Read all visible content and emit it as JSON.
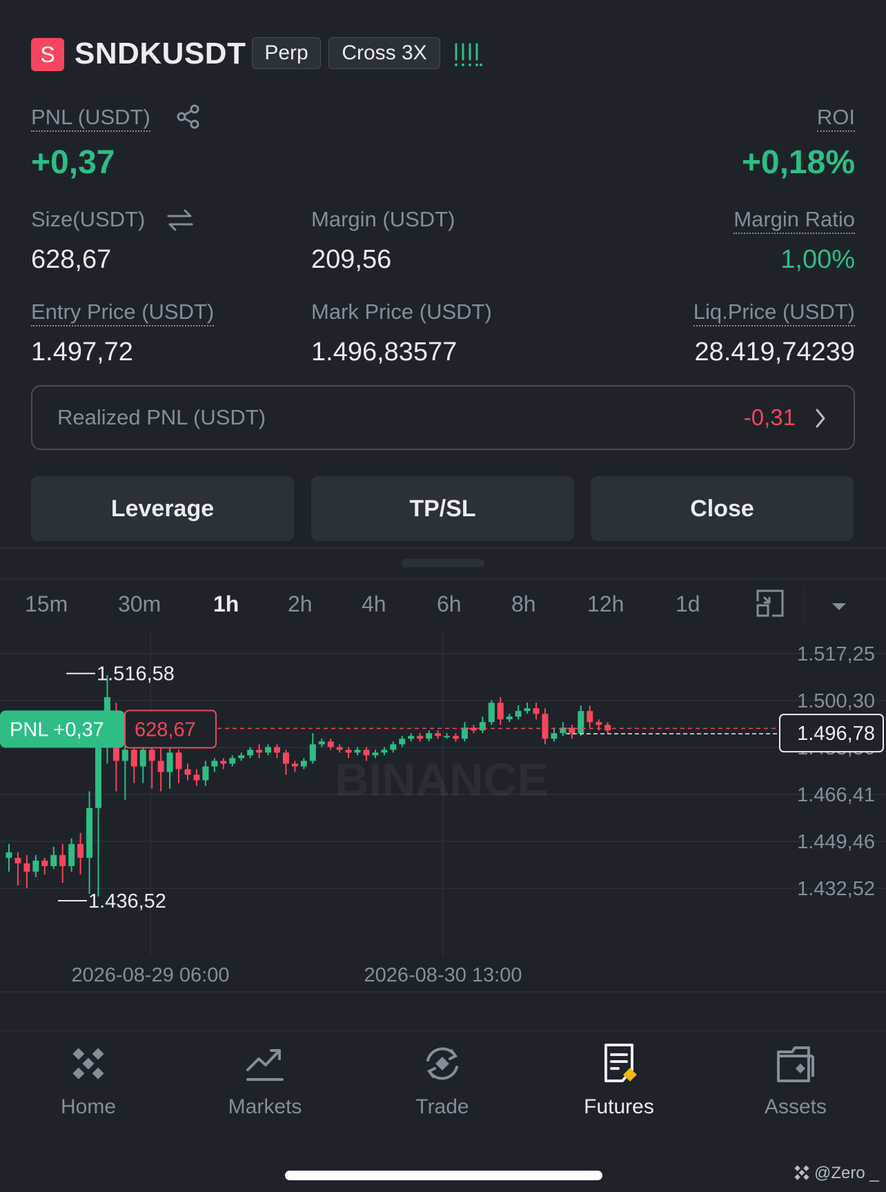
{
  "header": {
    "logo_letter": "S",
    "symbol": "SNDKUSDT",
    "tag_perp": "Perp",
    "tag_margin": "Cross 3X"
  },
  "stats": {
    "pnl_label": "PNL (USDT)",
    "pnl_value": "+0,37",
    "roi_label": "ROI",
    "roi_value": "+0,18%",
    "size_label": "Size(USDT)",
    "size_value": "628,67",
    "margin_label": "Margin (USDT)",
    "margin_value": "209,56",
    "margin_ratio_label": "Margin Ratio",
    "margin_ratio_value": "1,00%",
    "entry_label": "Entry Price (USDT)",
    "entry_value": "1.497,72",
    "mark_label": "Mark Price (USDT)",
    "mark_value": "1.496,83577",
    "liq_label": "Liq.Price (USDT)",
    "liq_value": "28.419,74239"
  },
  "realized": {
    "label": "Realized PNL (USDT)",
    "value": "-0,31"
  },
  "actions": {
    "leverage": "Leverage",
    "tpsl": "TP/SL",
    "close": "Close"
  },
  "timeframes": [
    "15m",
    "30m",
    "1h",
    "2h",
    "4h",
    "6h",
    "8h",
    "12h",
    "1d"
  ],
  "active_timeframe": "1h",
  "chart_data": {
    "type": "candlestick",
    "y_ticks": [
      "1.517,25",
      "1.500,30",
      "1.483,36",
      "1.466,41",
      "1.449,46",
      "1.432,52"
    ],
    "y_tick_values": [
      1517.25,
      1500.3,
      1483.36,
      1466.41,
      1449.46,
      1432.52
    ],
    "ylim": [
      1426,
      1524
    ],
    "x_labels": [
      "2026-08-29 06:00",
      "2026-08-30 13:00"
    ],
    "high_label": "1.516,58",
    "low_label": "1.436,52",
    "position_pnl_label": "PNL +0,37",
    "position_size_label": "628,67",
    "entry_price": 1497.72,
    "current_price_label": "1.496,78",
    "current_price": 1496.78,
    "up_color": "#2ebd85",
    "down_color": "#f6465d",
    "watermark": "BINANCE",
    "candles": [
      [
        1451,
        1453,
        1446,
        1456
      ],
      [
        1451,
        1449,
        1441,
        1453
      ],
      [
        1449,
        1446,
        1440,
        1452
      ],
      [
        1446,
        1450,
        1444,
        1452
      ],
      [
        1450,
        1448,
        1445,
        1451
      ],
      [
        1448,
        1452,
        1447,
        1455
      ],
      [
        1452,
        1448,
        1442,
        1456
      ],
      [
        1448,
        1456,
        1446,
        1458
      ],
      [
        1456,
        1451,
        1445,
        1460
      ],
      [
        1451,
        1469,
        1438,
        1475
      ],
      [
        1469,
        1495,
        1437,
        1500
      ],
      [
        1495,
        1509,
        1485,
        1517
      ],
      [
        1498,
        1486,
        1475,
        1507
      ],
      [
        1486,
        1490,
        1472,
        1496
      ],
      [
        1490,
        1484,
        1478,
        1493
      ],
      [
        1484,
        1490,
        1478,
        1496
      ],
      [
        1490,
        1486,
        1476,
        1494
      ],
      [
        1486,
        1482,
        1475,
        1491
      ],
      [
        1482,
        1489,
        1476,
        1491
      ],
      [
        1489,
        1483,
        1478,
        1490
      ],
      [
        1483,
        1481,
        1479,
        1485
      ],
      [
        1481,
        1479,
        1477,
        1483
      ],
      [
        1479,
        1484,
        1477,
        1486
      ],
      [
        1484,
        1486,
        1482,
        1487
      ],
      [
        1486,
        1485,
        1483,
        1487
      ],
      [
        1485,
        1487,
        1484,
        1488
      ],
      [
        1487,
        1488,
        1486,
        1489
      ],
      [
        1488,
        1490,
        1487,
        1491
      ],
      [
        1490,
        1489,
        1487,
        1492
      ],
      [
        1489,
        1491,
        1488,
        1492
      ],
      [
        1491,
        1489,
        1487,
        1492
      ],
      [
        1489,
        1485,
        1481,
        1490
      ],
      [
        1485,
        1484,
        1482,
        1486
      ],
      [
        1484,
        1486,
        1483,
        1487
      ],
      [
        1486,
        1492,
        1485,
        1496
      ],
      [
        1492,
        1493,
        1491,
        1494
      ],
      [
        1493,
        1491,
        1490,
        1494
      ],
      [
        1491,
        1490,
        1489,
        1492
      ],
      [
        1490,
        1489,
        1487,
        1491
      ],
      [
        1489,
        1490,
        1488,
        1491
      ],
      [
        1490,
        1488,
        1486,
        1491
      ],
      [
        1488,
        1489,
        1487,
        1490
      ],
      [
        1489,
        1490,
        1488,
        1491
      ],
      [
        1490,
        1492,
        1489,
        1493
      ],
      [
        1492,
        1494,
        1491,
        1495
      ],
      [
        1494,
        1495,
        1493,
        1496
      ],
      [
        1495,
        1494,
        1493,
        1496
      ],
      [
        1494,
        1496,
        1493,
        1497
      ],
      [
        1496,
        1495,
        1494,
        1497
      ],
      [
        1495,
        1495,
        1494,
        1496
      ],
      [
        1495,
        1494,
        1493,
        1496
      ],
      [
        1494,
        1498,
        1493,
        1500
      ],
      [
        1498,
        1497,
        1496,
        1499
      ],
      [
        1497,
        1500,
        1496,
        1502
      ],
      [
        1500,
        1507,
        1499,
        1508
      ],
      [
        1507,
        1501,
        1499,
        1509
      ],
      [
        1501,
        1502,
        1500,
        1503
      ],
      [
        1502,
        1504,
        1501,
        1506
      ],
      [
        1504,
        1505,
        1503,
        1507
      ],
      [
        1505,
        1503,
        1501,
        1507
      ],
      [
        1503,
        1494,
        1492,
        1505
      ],
      [
        1494,
        1496,
        1493,
        1498
      ],
      [
        1496,
        1498,
        1495,
        1500
      ],
      [
        1498,
        1496,
        1494,
        1499
      ],
      [
        1496,
        1504,
        1495,
        1506
      ],
      [
        1504,
        1500,
        1498,
        1506
      ],
      [
        1500,
        1499,
        1497,
        1501
      ],
      [
        1499,
        1497,
        1496,
        1500
      ]
    ]
  },
  "nav": {
    "home": "Home",
    "markets": "Markets",
    "trade": "Trade",
    "futures": "Futures",
    "assets": "Assets"
  },
  "watermark_text": "@Zero _"
}
